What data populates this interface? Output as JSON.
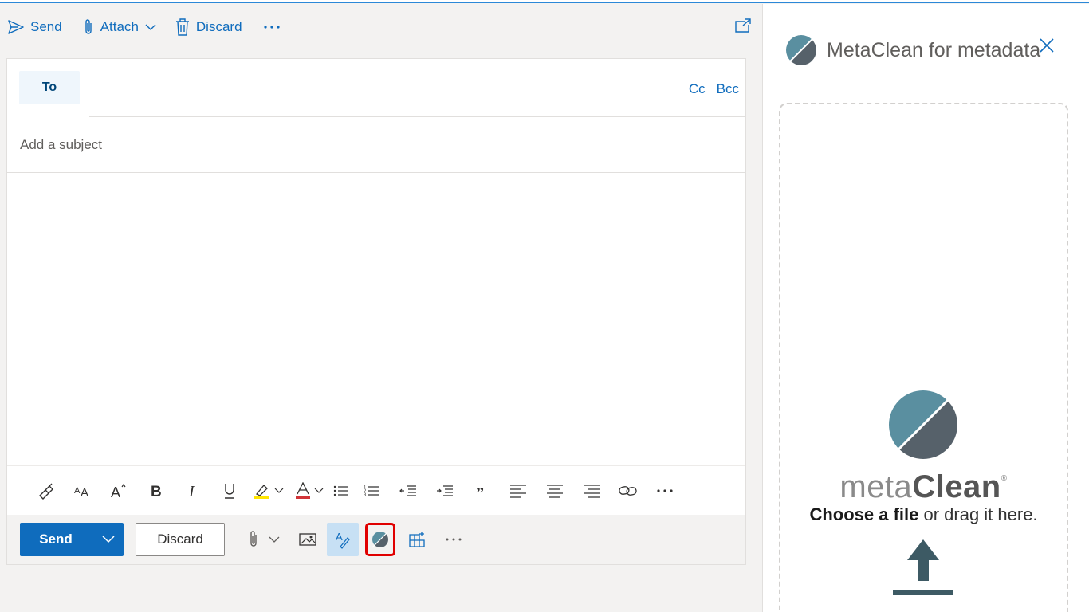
{
  "topbar": {
    "send_label": "Send",
    "attach_label": "Attach",
    "discard_label": "Discard"
  },
  "compose": {
    "to_label": "To",
    "cc_label": "Cc",
    "bcc_label": "Bcc",
    "subject_placeholder": "Add a subject",
    "subject_value": ""
  },
  "format_toolbar": {
    "buttons": [
      "format-painter-icon",
      "font-size-icon",
      "grow-font-icon",
      "bold-icon",
      "italic-icon",
      "underline-icon",
      "highlight-icon",
      "font-color-icon",
      "bullets-icon",
      "numbering-icon",
      "decrease-indent-icon",
      "increase-indent-icon",
      "quote-icon",
      "align-left-icon",
      "align-center-icon",
      "align-right-icon",
      "link-icon",
      "more-icon"
    ]
  },
  "action_bar": {
    "send_label": "Send",
    "discard_label": "Discard"
  },
  "side_pane": {
    "title": "MetaClean for metadata",
    "wordmark_thin": "meta",
    "wordmark_bold": "Clean",
    "wordmark_reg": "®",
    "choose_bold": "Choose a file",
    "choose_rest": " or drag it here."
  },
  "colors": {
    "accent": "#0f6cbd",
    "logo_light": "#5a8fa0",
    "logo_dark": "#56616a",
    "highlight_red": "#e00000"
  }
}
